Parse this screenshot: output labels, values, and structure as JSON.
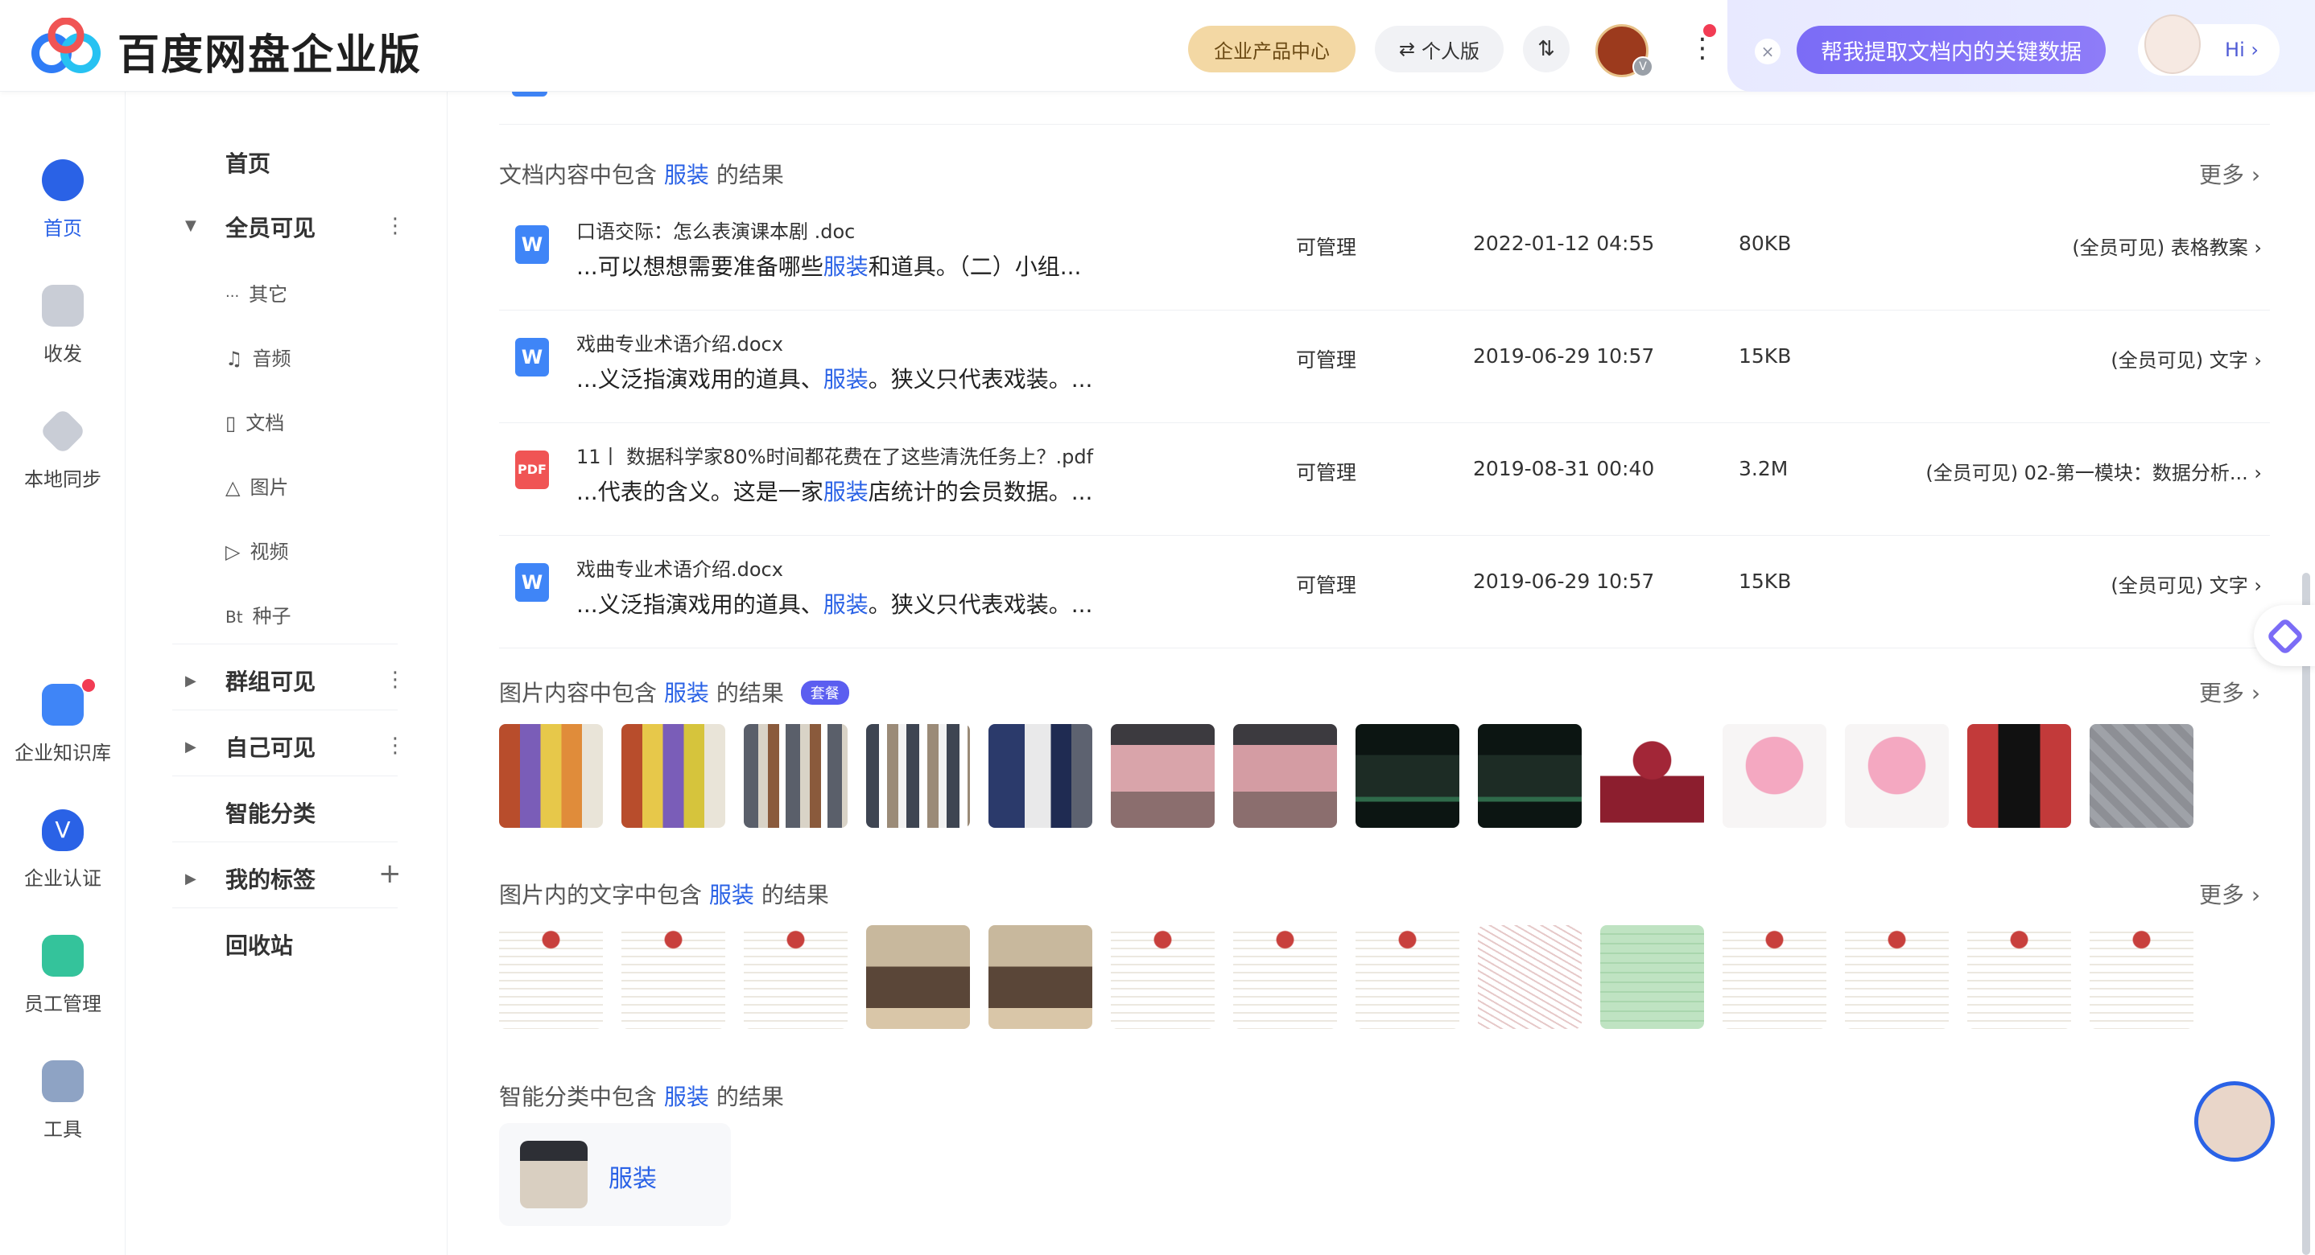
{
  "header": {
    "brand": "百度网盘企业版",
    "product_center": "企业产品中心",
    "personal": "个人版",
    "swap_icon": "⇅",
    "ai_prompt": "帮我提取文档内的关键数据",
    "ai_hi": "Hi ›",
    "avatar_badge": "V"
  },
  "leftnav": [
    {
      "label": "首页",
      "icon": "home-icon",
      "active": true
    },
    {
      "label": "收发",
      "icon": "send-receive-icon"
    },
    {
      "label": "本地同步",
      "icon": "sync-icon"
    },
    {
      "label": "企业知识库",
      "icon": "knowledge-base-icon"
    },
    {
      "label": "企业认证",
      "icon": "verify-icon"
    },
    {
      "label": "员工管理",
      "icon": "staff-icon"
    },
    {
      "label": "工具",
      "icon": "tools-icon"
    }
  ],
  "sidebar": {
    "home": "首页",
    "all_visible": "全员可见",
    "sub": [
      {
        "label": "其它",
        "icon": "···"
      },
      {
        "label": "音频",
        "icon": "♫"
      },
      {
        "label": "文档",
        "icon": "▯"
      },
      {
        "label": "图片",
        "icon": "△"
      },
      {
        "label": "视频",
        "icon": "▷"
      },
      {
        "label": "种子",
        "icon": "Bt"
      }
    ],
    "group_visible": "群组可见",
    "self_visible": "自己可见",
    "smart_category": "智能分类",
    "my_tags": "我的标签",
    "recycle_bin": "回收站"
  },
  "sections": {
    "doc_prefix": "文档内容中包含",
    "img_prefix": "图片内容中包含",
    "imgtext_prefix": "图片内的文字中包含",
    "cat_prefix": "智能分类中包含",
    "keyword": "服装",
    "suffix": "的结果",
    "badge": "套餐",
    "more": "更多 ›"
  },
  "docs": [
    {
      "name": "口语交际：怎么表演课本剧 .doc",
      "snip_a": "...可以想想需要准备哪些",
      "snip_b": "和道具。（二）小组...",
      "perm": "可管理",
      "date": "2022-01-12 04:55",
      "size": "80KB",
      "loc": "(全员可见) 表格教案 ›",
      "type": "W"
    },
    {
      "name": "戏曲专业术语介绍.docx",
      "snip_a": "...义泛指演戏用的道具、",
      "snip_b": "。狭义只代表戏装。...",
      "perm": "可管理",
      "date": "2019-06-29 10:57",
      "size": "15KB",
      "loc": "(全员可见) 文字 ›",
      "type": "W"
    },
    {
      "name": "11丨 数据科学家80%时间都花费在了这些清洗任务上？.pdf",
      "snip_a": "...代表的含义。这是一家",
      "snip_b": "店统计的会员数据。...",
      "perm": "可管理",
      "date": "2019-08-31 00:40",
      "size": "3.2M",
      "loc": "(全员可见) 02-第一模块：数据分析... ›",
      "type": "PDF"
    },
    {
      "name": "戏曲专业术语介绍.docx",
      "snip_a": "...义泛指演戏用的道具、",
      "snip_b": "。狭义只代表戏装。...",
      "perm": "可管理",
      "date": "2019-06-29 10:57",
      "size": "15KB",
      "loc": "(全员可见) 文字 ›",
      "type": "W"
    }
  ],
  "category": {
    "label": "服装"
  }
}
